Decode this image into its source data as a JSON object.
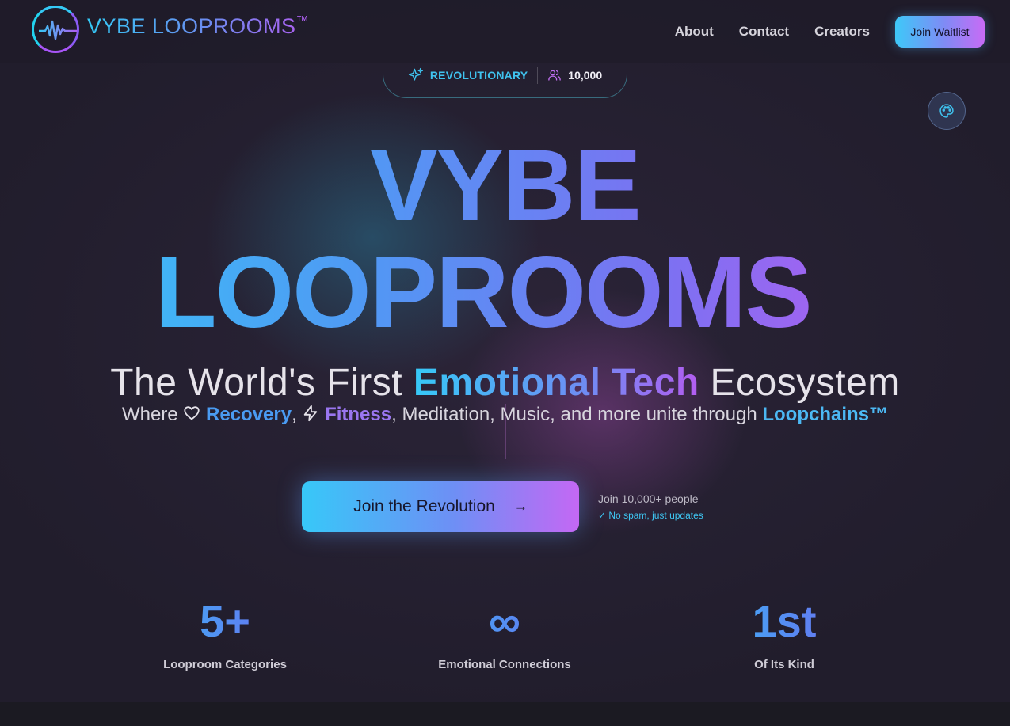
{
  "header": {
    "brand": "VYBE LOOPROOMS",
    "brand_mark": "™",
    "nav": [
      "About",
      "Contact",
      "Creators"
    ],
    "cta_label": "Join Waitlist"
  },
  "badge": {
    "label": "REVOLUTIONARY",
    "count": "10,000",
    "icons": [
      "sparkles-icon",
      "users-icon"
    ]
  },
  "theme_button_icon": "palette-icon",
  "hero": {
    "title_line1": "VYBE",
    "title_line2": "LOOPROOMS",
    "title_mark": "™",
    "subtitle_before": "The World's First ",
    "subtitle_highlight": "Emotional Tech",
    "subtitle_after": " Ecosystem",
    "tagline_where": "Where ",
    "tagline_recovery": "Recovery",
    "tagline_comma": ", ",
    "tagline_fitness": "Fitness",
    "tagline_rest": ", Meditation, Music, and more unite through ",
    "tagline_loopchains": "Loopchains™"
  },
  "cta": {
    "label": "Join the Revolution",
    "arrow": "→",
    "people": "Join 10,000+ people",
    "no_spam": "✓ No spam, just updates"
  },
  "stats": [
    {
      "value": "5+",
      "label": "Looproom Categories"
    },
    {
      "value": "∞",
      "label": "Emotional Connections"
    },
    {
      "value": "1st",
      "label": "Of Its Kind"
    }
  ],
  "colors": {
    "accent_cyan": "#36c9f7",
    "accent_blue": "#4f9af4",
    "accent_purple": "#b35df0",
    "background": "#211d2c"
  }
}
